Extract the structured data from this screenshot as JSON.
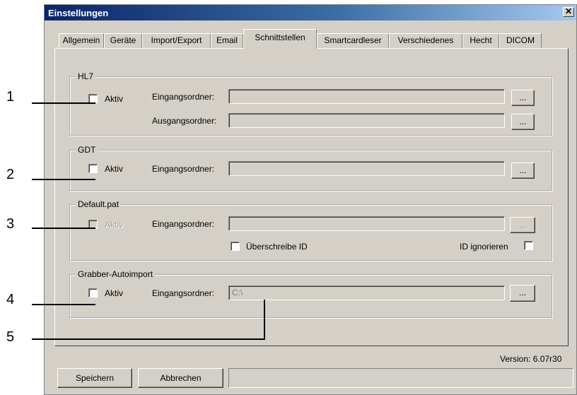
{
  "window": {
    "title": "Einstellungen",
    "close_glyph": "✕"
  },
  "tabs": [
    {
      "label": "Allgemein"
    },
    {
      "label": "Geräte"
    },
    {
      "label": "Import/Export"
    },
    {
      "label": "Email"
    },
    {
      "label": "Schnittstellen",
      "active": true
    },
    {
      "label": "Smartcardleser"
    },
    {
      "label": "Verschiedenes"
    },
    {
      "label": "Hecht"
    },
    {
      "label": "DICOM"
    }
  ],
  "groups": {
    "hl7": {
      "title": "HL7",
      "aktiv_label": "Aktiv",
      "aktiv_checked": false,
      "input_label": "Eingangsordner:",
      "input_value": "",
      "output_label": "Ausgangsordner:",
      "output_value": "",
      "browse_label": "..."
    },
    "gdt": {
      "title": "GDT",
      "aktiv_label": "Aktiv",
      "aktiv_checked": false,
      "input_label": "Eingangsordner:",
      "input_value": "",
      "browse_label": "..."
    },
    "default_pat": {
      "title": "Default.pat",
      "aktiv_label": "Aktiv",
      "aktiv_checked": false,
      "input_label": "Eingangsordner:",
      "input_value": "",
      "browse_label": "...",
      "overwrite_label": "Überschreibe ID",
      "ignore_label": "ID ignorieren"
    },
    "grabber": {
      "title": "Grabber-Autoimport",
      "aktiv_label": "Aktiv",
      "aktiv_checked": false,
      "input_label": "Eingangsordner:",
      "input_value": "C:\\",
      "browse_label": "..."
    }
  },
  "version": "Version: 6.07r30",
  "footer": {
    "save_label": "Speichern",
    "cancel_label": "Abbrechen"
  },
  "callouts": [
    "1",
    "2",
    "3",
    "4",
    "5"
  ]
}
